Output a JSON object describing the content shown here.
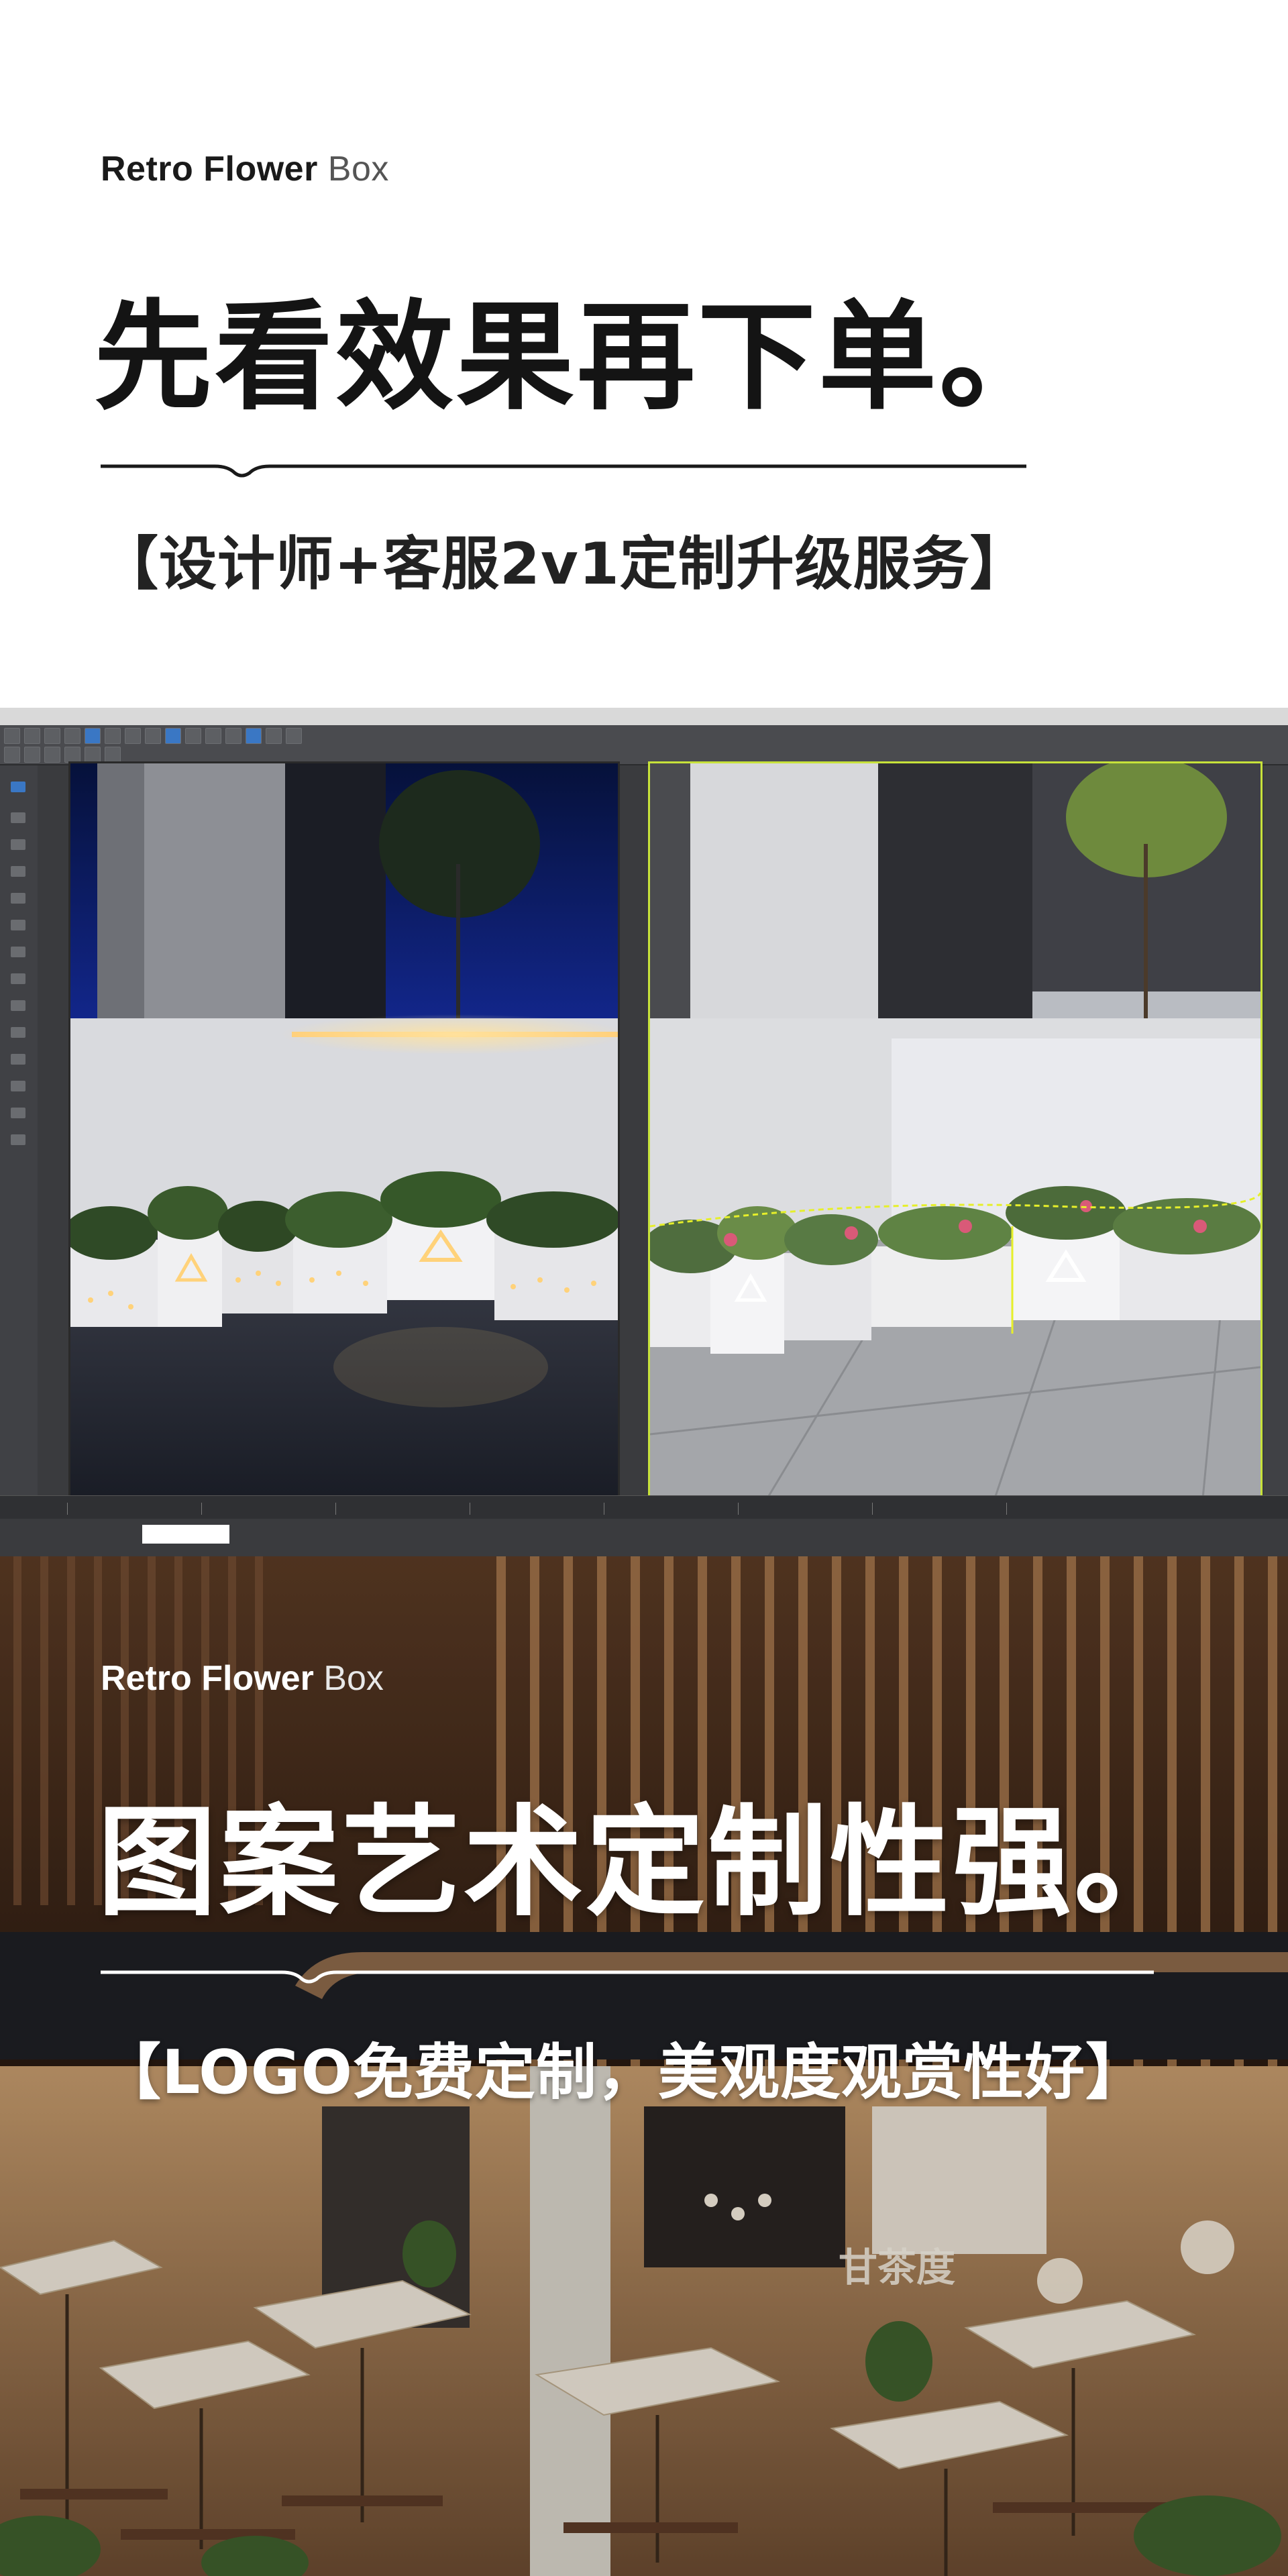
{
  "section1": {
    "brand_bold": "Retro Flower",
    "brand_light": " Box",
    "headline": "先看效果再下单。",
    "subline": "【设计师+客服2v1定制升级服务】"
  },
  "software": {
    "title": "",
    "status_left": "",
    "status_right": ""
  },
  "section2": {
    "brand_bold": "Retro Flower",
    "brand_light": " Box",
    "headline": "图案艺术定制性强。",
    "subline": "【LOGO免费定制，美观度观赏性好】"
  },
  "colors": {
    "viewport_active_border": "#c7e23a",
    "planter_light": "#ffd27a",
    "ui_dark": "#3a3b3e"
  }
}
